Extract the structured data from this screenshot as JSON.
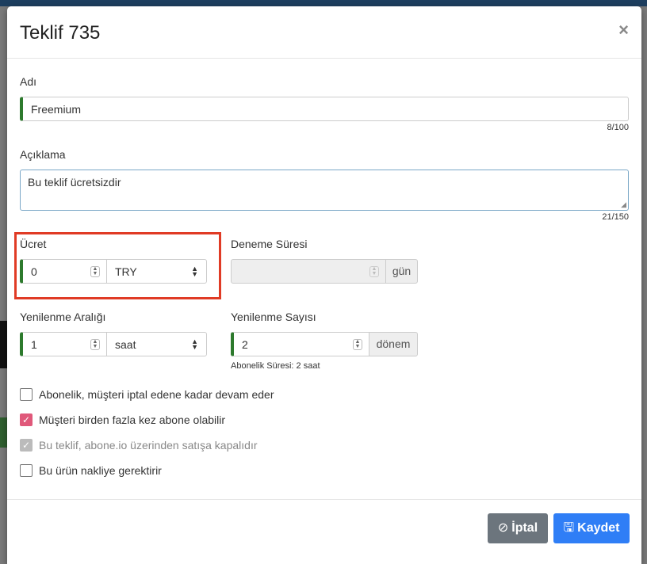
{
  "modal": {
    "title": "Teklif 735",
    "close": "×"
  },
  "form": {
    "name": {
      "label": "Adı",
      "value": "Freemium",
      "counter": "8/100"
    },
    "description": {
      "label": "Açıklama",
      "value": "Bu teklif ücretsizdir",
      "counter": "21/150"
    },
    "price": {
      "label": "Ücret",
      "value": "0",
      "currency": "TRY"
    },
    "trial": {
      "label": "Deneme Süresi",
      "value": "",
      "unit": "gün"
    },
    "renewal_interval": {
      "label": "Yenilenme Aralığı",
      "value": "1",
      "unit": "saat"
    },
    "renewal_count": {
      "label": "Yenilenme Sayısı",
      "value": "2",
      "unit": "dönem",
      "help": "Abonelik Süresi: 2 saat"
    }
  },
  "checkboxes": [
    {
      "label": "Abonelik, müşteri iptal edene kadar devam eder",
      "checked": false
    },
    {
      "label": "Müşteri birden fazla kez abone olabilir",
      "checked": true
    },
    {
      "label": "Bu teklif, abone.io üzerinden satışa kapalıdır",
      "checked": true,
      "disabled": true
    },
    {
      "label": "Bu ürün nakliye gerektirir",
      "checked": false
    }
  ],
  "footer": {
    "cancel_label": "İptal",
    "save_label": "Kaydet"
  },
  "colors": {
    "accent_green": "#2d7a2d",
    "highlight_red": "#e03b25",
    "checkbox_pink": "#e0587a",
    "save_blue": "#2f7ef6",
    "cancel_gray": "#6c757d"
  }
}
